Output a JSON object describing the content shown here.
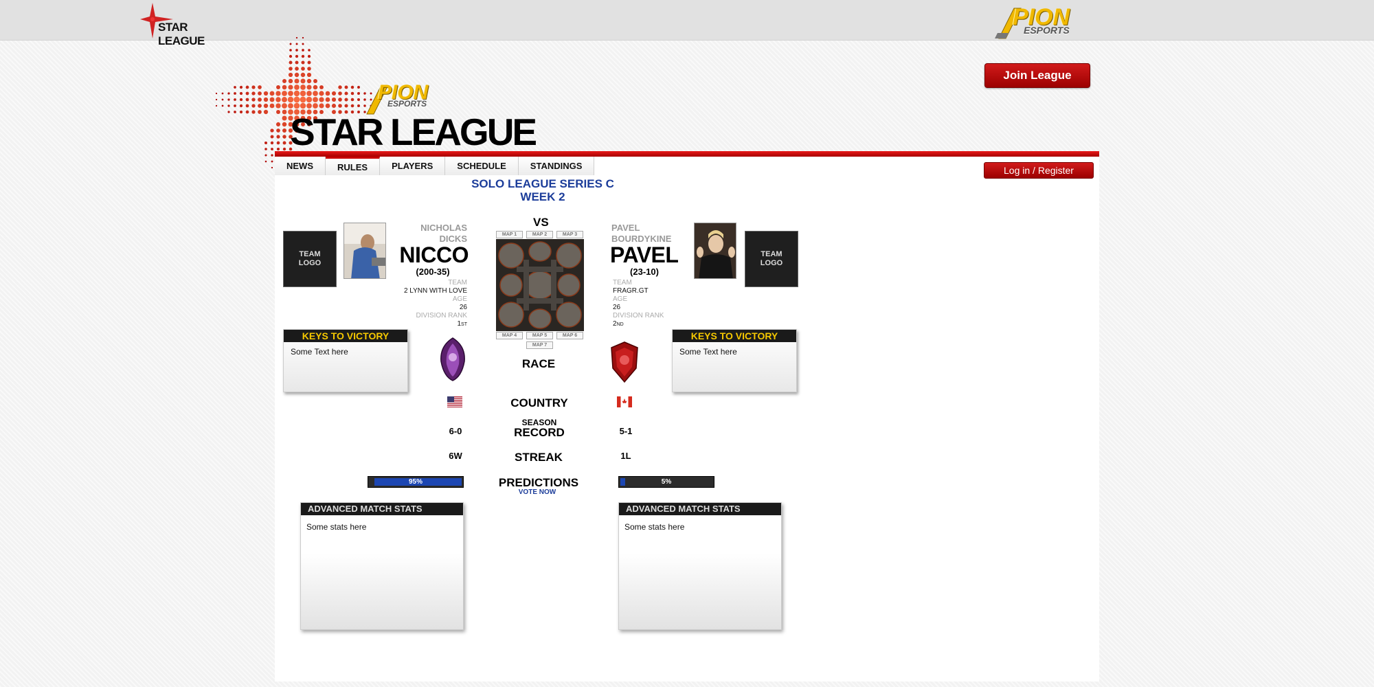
{
  "top": {
    "brand_small": "STAR LEAGUE",
    "sponsor_pion": "PION",
    "sponsor_esports": "ESPORTS"
  },
  "header": {
    "join_label": "Join League",
    "title": "STAR LEAGUE",
    "login_label": "Log in / Register"
  },
  "nav": {
    "items": [
      {
        "label": "NEWS"
      },
      {
        "label": "RULES"
      },
      {
        "label": "PLAYERS"
      },
      {
        "label": "SCHEDULE"
      },
      {
        "label": "STANDINGS"
      }
    ],
    "active": "RULES"
  },
  "match": {
    "series": "SOLO LEAGUE SERIES C",
    "week": "WEEK 2",
    "vs": "VS",
    "vote_now": "VOTE NOW"
  },
  "maps": [
    "MAP 1",
    "MAP 2",
    "MAP 3",
    "MAP 4",
    "MAP 5",
    "MAP 6",
    "MAP 7"
  ],
  "labels": {
    "team_logo_1": "TEAM",
    "team_logo_2": "LOGO",
    "team": "TEAM",
    "age": "AGE",
    "division_rank": "DIVISION RANK",
    "race": "RACE",
    "country": "COUNTRY",
    "season": "SEASON",
    "record": "RECORD",
    "streak": "STREAK",
    "predictions": "PREDICTIONS",
    "keys": "KEYS TO VICTORY",
    "advanced": "ADVANCED MATCH STATS"
  },
  "player1": {
    "first": "NICHOLAS",
    "last": "DICKS",
    "handle": "NICCO",
    "record": "(200-35)",
    "team": "2 LYNN WITH LOVE",
    "age": "26",
    "rank_num": "1",
    "rank_suffix": "ST",
    "race_icon": "zerg-icon",
    "country_flag": "us-flag-icon",
    "season_record": "6-0",
    "streak": "6W",
    "prediction": "95%",
    "prediction_value": 0.95,
    "keys_text": "Some Text here",
    "stats_text": "Some stats here"
  },
  "player2": {
    "first": "PAVEL",
    "last": "BOURDYKINE",
    "handle": "PAVEL",
    "record": "(23-10)",
    "team": "FRAGR.GT",
    "age": "26",
    "rank_num": "2",
    "rank_suffix": "ND",
    "race_icon": "terran-icon",
    "country_flag": "canada-flag-icon",
    "season_record": "5-1",
    "streak": "1L",
    "prediction": "5%",
    "prediction_value": 0.05,
    "keys_text": "Some Text here",
    "stats_text": "Some stats here"
  },
  "colors": {
    "brand_red": "#c70000",
    "title_blue": "#1c3d9a",
    "keys_yellow": "#f6c800"
  }
}
